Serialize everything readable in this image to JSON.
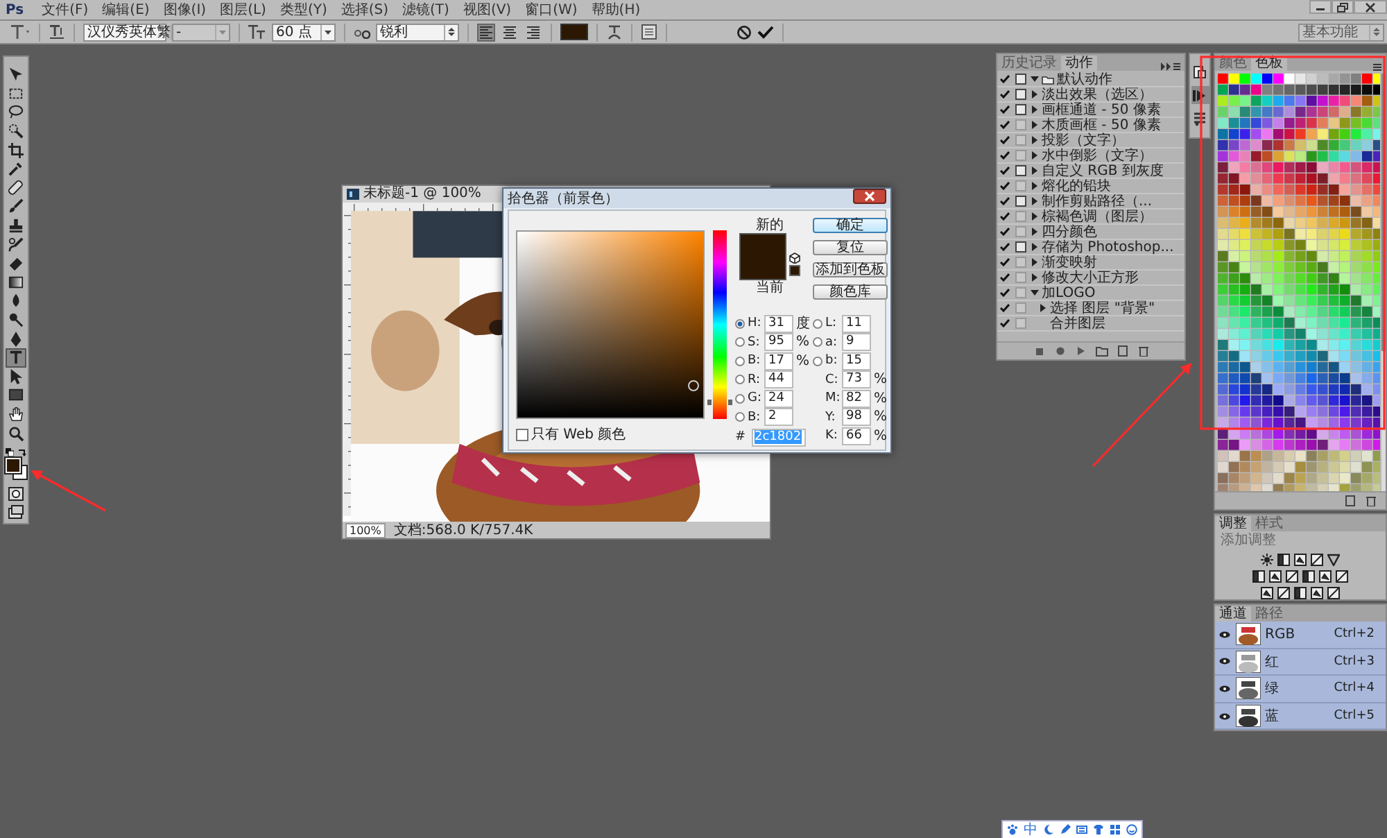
{
  "menu_bar": {
    "logo": "Ps",
    "items": [
      "文件(F)",
      "编辑(E)",
      "图像(I)",
      "图层(L)",
      "类型(Y)",
      "选择(S)",
      "滤镜(T)",
      "视图(V)",
      "窗口(W)",
      "帮助(H)"
    ]
  },
  "options_bar": {
    "font_family": "汉仪秀英体繁",
    "font_style": "-",
    "font_size": "60 点",
    "antialias": "锐利",
    "alignment": [
      {
        "selected": true
      },
      {
        "selected": false
      },
      {
        "selected": false
      }
    ],
    "workspace": "基本功能"
  },
  "toolbar": {
    "tools": [
      {
        "kind": "move",
        "selected": false
      },
      {
        "kind": "marquee",
        "selected": false
      },
      {
        "kind": "lasso",
        "selected": false
      },
      {
        "kind": "quick-select",
        "selected": false
      },
      {
        "kind": "crop",
        "selected": false
      },
      {
        "kind": "eyedropper",
        "selected": false
      },
      {
        "kind": "healing",
        "selected": false
      },
      {
        "kind": "brush",
        "selected": false
      },
      {
        "kind": "stamp",
        "selected": false
      },
      {
        "kind": "history-brush",
        "selected": false
      },
      {
        "kind": "eraser",
        "selected": false
      },
      {
        "kind": "gradient",
        "selected": false
      },
      {
        "kind": "blur",
        "selected": false
      },
      {
        "kind": "dodge",
        "selected": false
      },
      {
        "kind": "pen",
        "selected": false
      },
      {
        "kind": "type",
        "selected": true
      },
      {
        "kind": "path-select",
        "selected": false
      },
      {
        "kind": "rectangle",
        "selected": false
      },
      {
        "kind": "hand",
        "selected": false
      },
      {
        "kind": "zoom",
        "selected": false
      }
    ],
    "colors": [
      {
        "kind": "foreground",
        "color": "#2c1802"
      },
      {
        "kind": "background",
        "color": "#ffffff"
      }
    ]
  },
  "document": {
    "title": "未标题-1 @ 100%",
    "zoom": "100%",
    "doc_info": "文档:568.0 K/757.4K"
  },
  "color_picker": {
    "title": "拾色器（前景色）",
    "swatches": [
      {
        "label": "新的",
        "color": "#2c1802"
      },
      {
        "label": "当前",
        "color": "#2c1802"
      }
    ],
    "buttons": [
      {
        "label": "确定",
        "default": true
      },
      {
        "label": "复位",
        "default": false
      },
      {
        "label": "添加到色板",
        "default": false
      },
      {
        "label": "颜色库",
        "default": false
      }
    ],
    "hue_slider": {
      "level": 0.086
    },
    "fields_left": [
      {
        "kind": "radio",
        "label": "H:",
        "value": "31",
        "unit": "度",
        "selected": true
      },
      {
        "kind": "radio",
        "label": "S:",
        "value": "95",
        "unit": "%",
        "selected": false
      },
      {
        "kind": "radio",
        "label": "B:",
        "value": "17",
        "unit": "%",
        "selected": false
      },
      {
        "kind": "radio",
        "label": "R:",
        "value": "44",
        "selected": false
      },
      {
        "kind": "radio",
        "label": "G:",
        "value": "24",
        "selected": false
      },
      {
        "kind": "radio",
        "label": "B:",
        "value": "2",
        "selected": false
      }
    ],
    "fields_right": [
      {
        "kind": "radio",
        "label": "L:",
        "value": "11",
        "selected": false
      },
      {
        "kind": "radio",
        "label": "a:",
        "value": "9",
        "selected": false
      },
      {
        "kind": "radio",
        "label": "b:",
        "value": "15",
        "selected": false
      },
      {
        "kind": "plain",
        "label": "C:",
        "value": "73",
        "unit": "%"
      },
      {
        "kind": "plain",
        "label": "M:",
        "value": "82",
        "unit": "%"
      },
      {
        "kind": "plain",
        "label": "Y:",
        "value": "98",
        "unit": "%"
      },
      {
        "kind": "plain",
        "label": "K:",
        "value": "66",
        "unit": "%"
      }
    ],
    "hex": {
      "label": "#",
      "value": "2c1802"
    },
    "web_only": {
      "label": "只有 Web 颜色",
      "checked": false
    }
  },
  "actions_panel": {
    "tabs": [
      {
        "label": "历史记录",
        "selected": false
      },
      {
        "label": "动作",
        "selected": true
      }
    ],
    "items": [
      {
        "name": "默认动作",
        "checked": true,
        "dialog": true,
        "expanded": true,
        "children": [
          {
            "name": "淡出效果（选区）",
            "checked": true,
            "dialog": true,
            "expanded": false
          },
          {
            "name": "画框通道 - 50 像素",
            "checked": true,
            "dialog": true,
            "expanded": false
          },
          {
            "name": "木质画框 - 50 像素",
            "checked": true,
            "dialog": false,
            "expanded": false
          },
          {
            "name": "投影（文字）",
            "checked": true,
            "dialog": false,
            "expanded": false
          },
          {
            "name": "水中倒影（文字）",
            "checked": true,
            "dialog": false,
            "expanded": false
          },
          {
            "name": "自定义 RGB 到灰度",
            "checked": true,
            "dialog": true,
            "expanded": false
          },
          {
            "name": "熔化的铅块",
            "checked": true,
            "dialog": false,
            "expanded": false
          },
          {
            "name": "制作剪贴路径（...",
            "checked": true,
            "dialog": true,
            "expanded": false
          },
          {
            "name": "棕褐色调（图层）",
            "checked": true,
            "dialog": false,
            "expanded": false
          },
          {
            "name": "四分颜色",
            "checked": true,
            "dialog": false,
            "expanded": false
          },
          {
            "name": "存储为 Photoshop...",
            "checked": true,
            "dialog": true,
            "expanded": false
          },
          {
            "name": "渐变映射",
            "checked": true,
            "dialog": false,
            "expanded": false
          },
          {
            "name": "修改大小正方形",
            "checked": true,
            "dialog": false,
            "expanded": false
          },
          {
            "name": "加LOGO",
            "checked": true,
            "dialog": false,
            "expanded": true,
            "children": [
              {
                "name": "选择 图层 \"背景\"",
                "checked": true,
                "dialog": false,
                "expanded": false
              },
              {
                "name": "合并图层",
                "checked": true,
                "dialog": false
              }
            ]
          }
        ]
      }
    ]
  },
  "swatches_panel": {
    "tabs": [
      {
        "label": "颜色",
        "selected": false
      },
      {
        "label": "色板",
        "selected": true
      }
    ]
  },
  "adjustments_panel": {
    "tabs": [
      {
        "label": "调整",
        "selected": true
      },
      {
        "label": "样式",
        "selected": false
      }
    ],
    "hint": "添加调整"
  },
  "channels_panel": {
    "tabs": [
      {
        "label": "通道",
        "selected": true
      },
      {
        "label": "路径",
        "selected": false
      }
    ],
    "channels": [
      {
        "name": "RGB",
        "shortcut": "Ctrl+2",
        "visible": true,
        "selected": true
      },
      {
        "name": "红",
        "shortcut": "Ctrl+3",
        "visible": true,
        "selected": true
      },
      {
        "name": "绿",
        "shortcut": "Ctrl+4",
        "visible": true,
        "selected": true
      },
      {
        "name": "蓝",
        "shortcut": "Ctrl+5",
        "visible": true,
        "selected": true
      }
    ]
  },
  "ime_bar": {
    "label": "中"
  }
}
